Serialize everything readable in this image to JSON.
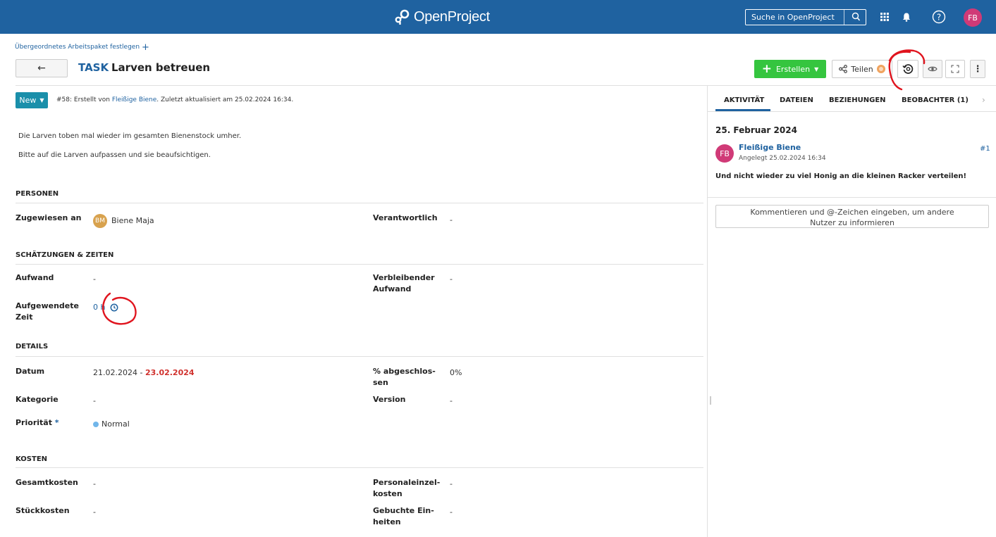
{
  "header": {
    "logo_text": "OpenProject",
    "search_label": "Suche in OpenProject",
    "avatar_initials": "FB"
  },
  "workpackage": {
    "parent_link": "Übergeordnetes Arbeitspaket festlegen",
    "type": "TASK",
    "title": "Larven betreuen",
    "status": "New",
    "meta_prefix": "#58: Erstellt von ",
    "meta_author": "Fleißige Biene",
    "meta_suffix": ". Zuletzt aktualisiert am 25.02.2024 16:34.",
    "description": [
      "Die Larven toben mal wieder im gesamten Bienenstock umher.",
      "Bitte auf die Larven aufpassen und sie beaufsichtigen."
    ]
  },
  "toolbar": {
    "create_label": "Erstellen",
    "share_label": "Teilen"
  },
  "sections": {
    "persons": {
      "title": "PERSONEN",
      "assignee_label": "Zugewiesen an",
      "assignee_initials": "BM",
      "assignee_name": "Biene Maja",
      "responsible_label": "Verantwortlich",
      "responsible_value": "-"
    },
    "estimates": {
      "title": "SCHÄTZUNGEN & ZEITEN",
      "work_label": "Aufwand",
      "work_value": "-",
      "remaining_label_1": "Verbleibender",
      "remaining_label_2": "Aufwand",
      "remaining_value": "-",
      "spent_label_1": "Aufgewendete",
      "spent_label_2": "Zeit",
      "spent_value": "0 h"
    },
    "details": {
      "title": "DETAILS",
      "date_label": "Datum",
      "date_start": "21.02.2024 - ",
      "date_end": "23.02.2024",
      "done_label_1": "% abgeschlos-",
      "done_label_2": "sen",
      "done_value": "0%",
      "category_label": "Kategorie",
      "category_value": "-",
      "version_label": "Version",
      "version_value": "-",
      "priority_label": "Priorität",
      "priority_required": "*",
      "priority_value": "Normal"
    },
    "costs": {
      "title": "KOSTEN",
      "total_label": "Gesamtkosten",
      "total_value": "-",
      "labor_label_1": "Personaleinzel-",
      "labor_label_2": "kosten",
      "labor_value": "-",
      "unit_label": "Stückkosten",
      "unit_value": "-",
      "booked_label_1": "Gebuchte Ein-",
      "booked_label_2": "heiten",
      "booked_value": "-"
    }
  },
  "activity": {
    "tabs": [
      "AKTIVITÄT",
      "DATEIEN",
      "BEZIEHUNGEN",
      "BEOBACHTER (1)"
    ],
    "date": "25. Februar 2024",
    "user_initials": "FB",
    "user": "Fleißige Biene",
    "created": "Angelegt 25.02.2024 16:34",
    "number": "#1",
    "comment": "Und nicht wieder zu viel Honig an die kleinen Racker verteilen!",
    "comment_placeholder": "Kommentieren und @-Zeichen eingeben, um andere Nutzer zu informieren"
  },
  "colors": {
    "header_bg": "#1f62a0",
    "create_green": "#35c53f",
    "status_teal": "#1a8faa",
    "annotation_red": "#e0141e"
  }
}
